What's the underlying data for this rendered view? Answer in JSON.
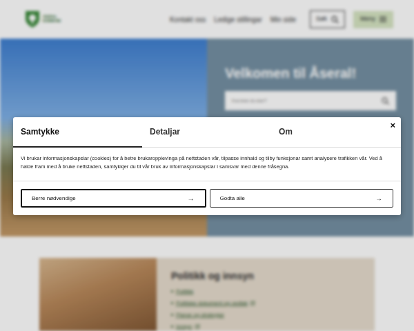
{
  "header": {
    "logo": [
      "ÅSERAL",
      "KOMMUNE"
    ],
    "links": [
      "Kontakt oss",
      "Ledige stillingar",
      "Min side"
    ],
    "search_button": "Søk",
    "menu_button": "Meny"
  },
  "hero": {
    "title": "Velkomen til Åseral!",
    "search": {
      "placeholder": "Kva leiter du etter?"
    }
  },
  "section": {
    "title": "Politikk og innsyn",
    "links": [
      {
        "label": "Politikk",
        "external": false
      },
      {
        "label": "Politiske dokument og vedtak",
        "external": true
      },
      {
        "label": "Planar og strategiar",
        "external": false
      },
      {
        "label": "Innsyn",
        "external": true
      }
    ]
  },
  "consent": {
    "tabs": [
      {
        "label": "Samtykke",
        "selected": true
      },
      {
        "label": "Detaljar",
        "selected": false
      },
      {
        "label": "Om",
        "selected": false
      }
    ],
    "close": "×",
    "text": "Vi brukar informasjonskapslar (cookies) for å betre brukaropplevinga på nettstaden vår, tilpasse innhald og tilby funksjonar samt analysere trafikken vår. Ved å halde fram med å bruke nettstaden, samtykkjer du til vår bruk av informasjonskapslar i samsvar med denne fråsegna.",
    "buttons": [
      {
        "label": "Berre nødvendige",
        "arrow": "→",
        "focused": true
      },
      {
        "label": "Godta alle",
        "arrow": "→",
        "focused": false
      }
    ]
  }
}
